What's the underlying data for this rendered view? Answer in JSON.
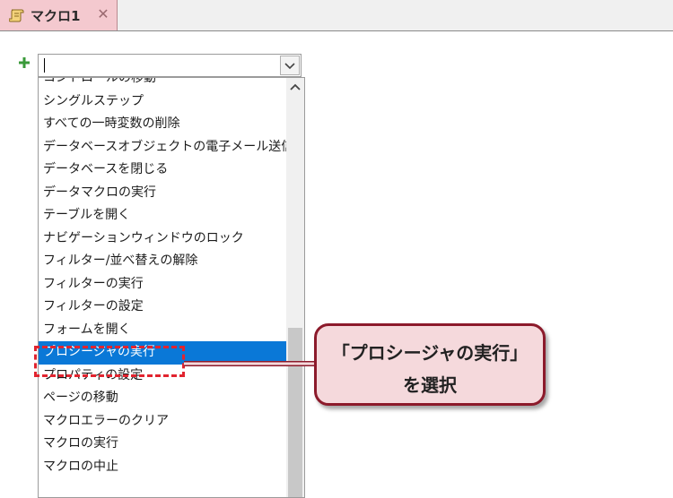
{
  "tab": {
    "title": "マクロ1",
    "icon": "macro-scroll-icon",
    "close_icon": "close-icon",
    "background_color": "#f4c9cf"
  },
  "action_combo": {
    "value": "",
    "add_icon": "plus-icon",
    "dropdown_icon": "chevron-down-icon"
  },
  "action_list": {
    "items": [
      "コントロールの移動",
      "シングルステップ",
      "すべての一時変数の削除",
      "データベースオブジェクトの電子メール送信",
      "データベースを閉じる",
      "データマクロの実行",
      "テーブルを開く",
      "ナビゲーションウィンドウのロック",
      "フィルター/並べ替えの解除",
      "フィルターの実行",
      "フィルターの設定",
      "フォームを開く",
      "プロシージャの実行",
      "プロパティの設定",
      "ページの移動",
      "マクロエラーのクリア",
      "マクロの実行",
      "マクロの中止"
    ],
    "selected_index": 12,
    "selected_color": "#0a78d7"
  },
  "annotation": {
    "line1": "「プロシージャの実行」",
    "line2": "を選択",
    "border_color": "#8c1a2b",
    "fill_color": "#f5d9dc",
    "highlight_color": "#e1242f"
  }
}
